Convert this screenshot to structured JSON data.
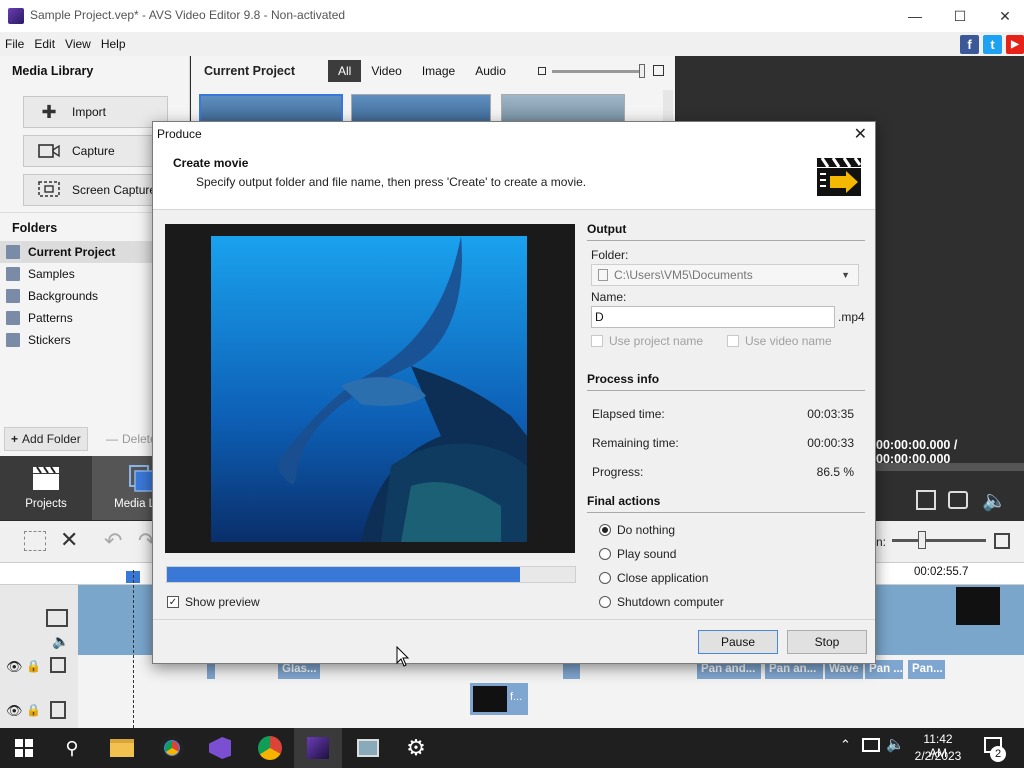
{
  "window": {
    "title": "Sample Project.vep* - AVS Video Editor 9.8 - Non-activated"
  },
  "menu": [
    "File",
    "Edit",
    "View",
    "Help"
  ],
  "social": {
    "facebook": "f",
    "twitter": "t",
    "youtube": "▶"
  },
  "media_library": {
    "title": "Media Library",
    "buttons": {
      "import": "Import",
      "capture": "Capture",
      "screen_capture": "Screen Capture"
    },
    "folders_title": "Folders",
    "folders": [
      "Current Project",
      "Samples",
      "Backgrounds",
      "Patterns",
      "Stickers"
    ],
    "add_folder": "Add Folder",
    "delete": "Delete"
  },
  "current_project": {
    "title": "Current Project",
    "filters": [
      "All",
      "Video",
      "Image",
      "Audio"
    ],
    "active_filter": "All"
  },
  "nav_tabs": {
    "projects": "Projects",
    "media_library": "Media Libr"
  },
  "preview": {
    "timecode": "00:00:00.000 / 00:00:00.000"
  },
  "timeline": {
    "ruler_time": "00:02:55.7",
    "zoom_label": "n:",
    "fx_chips": [
      "Glas...",
      "Pan and...",
      "Pan an...",
      "Wave",
      "Pan ...",
      "Pan..."
    ],
    "overlay_label": "f..."
  },
  "dialog": {
    "title": "Produce",
    "header_title": "Create movie",
    "header_desc": "Specify output folder and file name, then press 'Create' to create a movie.",
    "output": {
      "section": "Output",
      "folder_label": "Folder:",
      "folder_value": "C:\\Users\\VM5\\Documents",
      "name_label": "Name:",
      "name_value": "D",
      "extension": ".mp4",
      "use_project_name": "Use project name",
      "use_video_name": "Use video name"
    },
    "process_info": {
      "section": "Process info",
      "elapsed_label": "Elapsed time:",
      "elapsed_value": "00:03:35",
      "remaining_label": "Remaining time:",
      "remaining_value": "00:00:33",
      "progress_label": "Progress:",
      "progress_value": "86.5 %",
      "progress_fraction": 0.865
    },
    "final_actions": {
      "section": "Final actions",
      "options": [
        "Do nothing",
        "Play sound",
        "Close application",
        "Shutdown computer"
      ],
      "selected": "Do nothing"
    },
    "show_preview": "Show preview",
    "buttons": {
      "pause": "Pause",
      "stop": "Stop"
    }
  },
  "taskbar": {
    "time": "11:42 AM",
    "date": "2/2/2023",
    "notification_count": "2"
  },
  "colors": {
    "accent": "#3a78d8",
    "timeline_clip": "#7aa6cc"
  }
}
